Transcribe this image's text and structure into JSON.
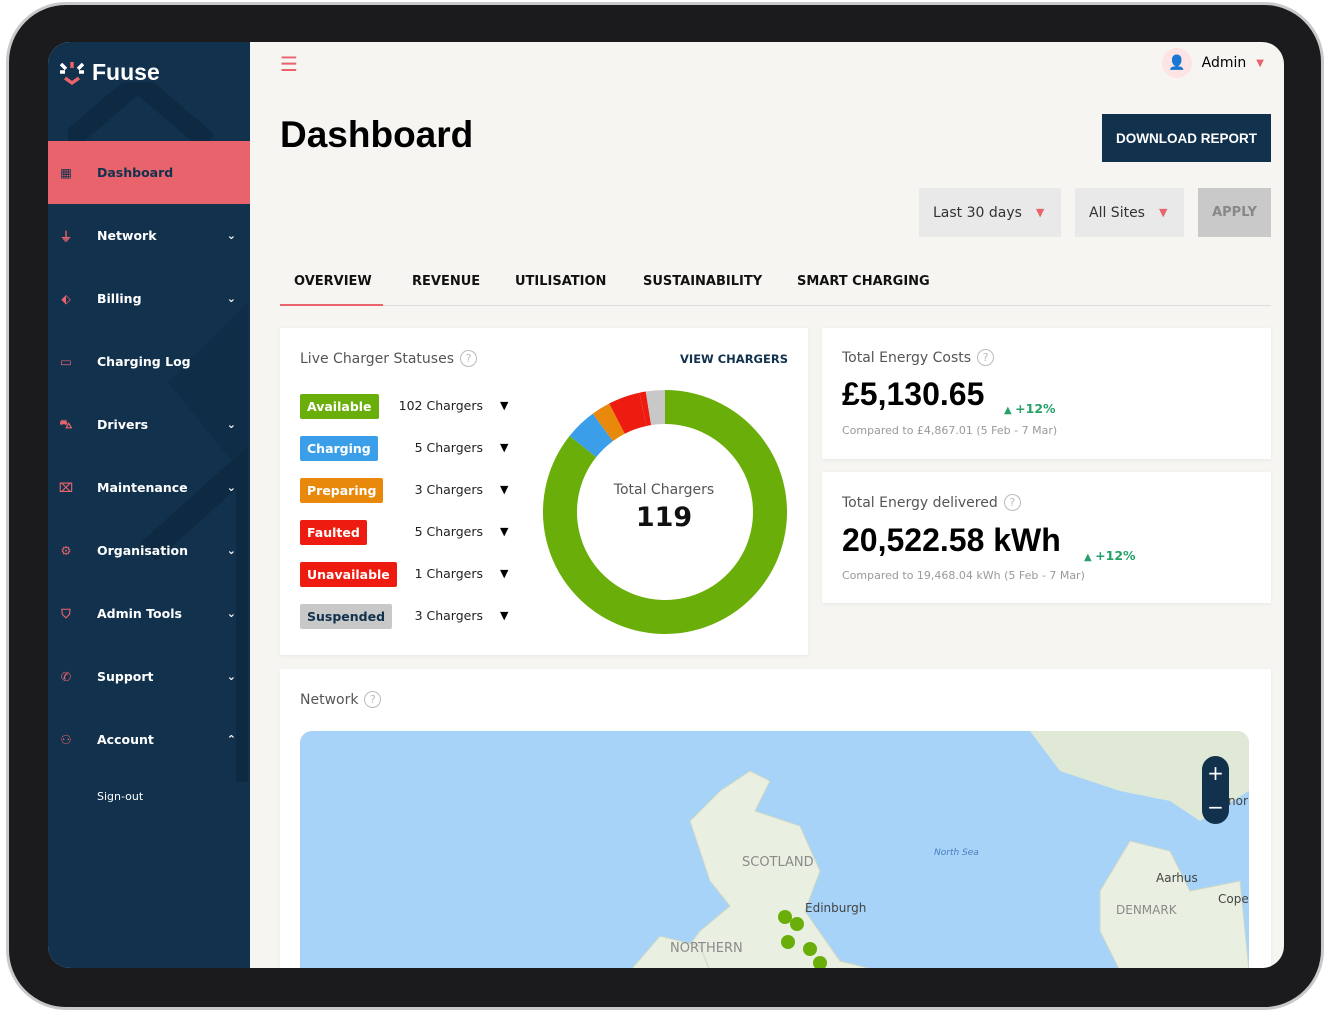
{
  "brand": {
    "name": "Fuuse"
  },
  "sidebar": {
    "items": [
      {
        "label": "Dashboard",
        "icon": "dashboard-icon",
        "active": true,
        "chevron": ""
      },
      {
        "label": "Network",
        "icon": "plug-icon",
        "chevron": "⌄"
      },
      {
        "label": "Billing",
        "icon": "tag-icon",
        "chevron": "⌄"
      },
      {
        "label": "Charging Log",
        "icon": "battery-icon",
        "chevron": ""
      },
      {
        "label": "Drivers",
        "icon": "car-icon",
        "chevron": "⌄"
      },
      {
        "label": "Maintenance",
        "icon": "ticket-icon",
        "chevron": "⌄"
      },
      {
        "label": "Organisation",
        "icon": "gear-icon",
        "chevron": "⌄"
      },
      {
        "label": "Admin Tools",
        "icon": "shield-icon",
        "chevron": "⌄"
      },
      {
        "label": "Support",
        "icon": "phone-icon",
        "chevron": "⌄"
      },
      {
        "label": "Account",
        "icon": "user-icon",
        "chevron": "⌃"
      }
    ],
    "signout": "Sign-out"
  },
  "header": {
    "user": "Admin",
    "title": "Dashboard",
    "download": "DOWNLOAD REPORT"
  },
  "filters": {
    "period": "Last 30 days",
    "sites": "All Sites",
    "apply": "APPLY"
  },
  "tabs": [
    "OVERVIEW",
    "REVENUE",
    "UTILISATION",
    "SUSTAINABILITY",
    "SMART CHARGING"
  ],
  "live": {
    "title": "Live Charger Statuses",
    "link": "VIEW CHARGERS",
    "total_label": "Total Chargers",
    "total": "119",
    "statuses": [
      {
        "label": "Available",
        "count": "102 Chargers",
        "n": 102,
        "color": "#6aae0a",
        "text": "#fff"
      },
      {
        "label": "Charging",
        "count": "5 Chargers",
        "n": 5,
        "color": "#3b9ee8",
        "text": "#fff"
      },
      {
        "label": "Preparing",
        "count": "3 Chargers",
        "n": 3,
        "color": "#e8890c",
        "text": "#fff"
      },
      {
        "label": "Faulted",
        "count": "5 Chargers",
        "n": 5,
        "color": "#ee1c10",
        "text": "#fff"
      },
      {
        "label": "Unavailable",
        "count": "1 Chargers",
        "n": 1,
        "color": "#ee1c10",
        "text": "#fff"
      },
      {
        "label": "Suspended",
        "count": "3 Chargers",
        "n": 3,
        "color": "#c8c8c8",
        "text": "#11314d"
      }
    ]
  },
  "costs": {
    "title": "Total Energy Costs",
    "value": "£5,130.65",
    "change": "+12%",
    "compare": "Compared to £4,867.01 (5 Feb - 7 Mar)"
  },
  "energy": {
    "title": "Total Energy delivered",
    "value": "20,522.58 kWh",
    "change": "+12%",
    "compare": "Compared to 19,468.04 kWh (5 Feb - 7 Mar)"
  },
  "network": {
    "title": "Network",
    "labels": {
      "scotland": "SCOTLAND",
      "edinburgh": "Edinburgh",
      "north_sea": "North Sea",
      "aarhus": "Aarhus",
      "denmark": "DENMARK",
      "cope": "Cope",
      "ni": "NORTHERN",
      "nor": "nor"
    }
  }
}
